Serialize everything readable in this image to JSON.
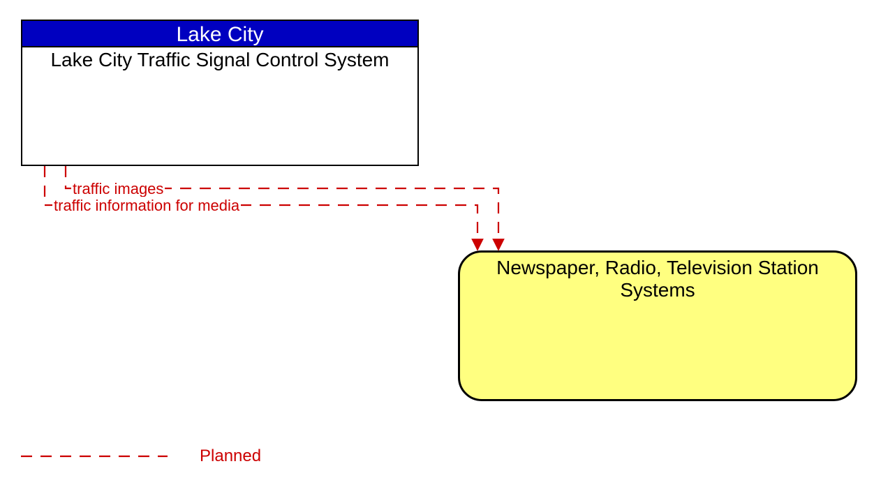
{
  "source": {
    "header": "Lake City",
    "body": "Lake City Traffic Signal Control System"
  },
  "target": {
    "title_line1": "Newspaper, Radio, Television Station",
    "title_line2": "Systems"
  },
  "flows": {
    "f1": "traffic images",
    "f2": "traffic information for media"
  },
  "legend": {
    "planned": "Planned"
  },
  "colors": {
    "header_bg": "#0000c0",
    "target_bg": "#ffff80",
    "flow": "#cc0000"
  }
}
